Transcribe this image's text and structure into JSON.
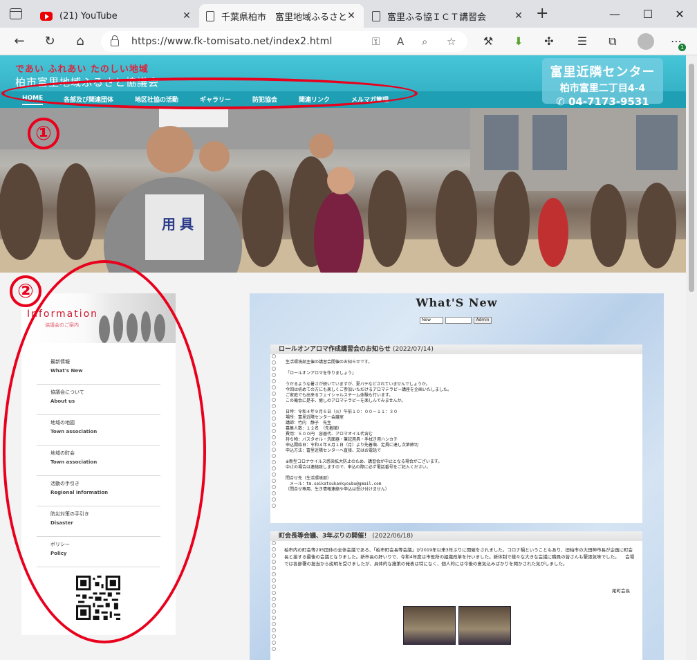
{
  "browser": {
    "tabs": [
      {
        "title": "(21) YouTube",
        "icon": "youtube-icon",
        "active": false
      },
      {
        "title": "千葉県柏市　富里地域ふるさと協議会",
        "icon": "page-icon",
        "active": true
      },
      {
        "title": "富里ふる協ＩＣＴ講習会",
        "icon": "page-icon",
        "active": false
      }
    ],
    "url": "https://www.fk-tomisato.net/index2.html",
    "profile_badge": "1"
  },
  "site": {
    "slogan": "であい ふれあい たのしい地域",
    "org_name": "柏市富里地域ふるさと協議会",
    "center": {
      "name": "富里近隣センター",
      "address": "柏市富里二丁目4-4",
      "tel": "✆ 04-7173-9531"
    },
    "nav": [
      "HOME",
      "各部及び関連団体",
      "地区社協の活動",
      "ギャラリー",
      "防犯協会",
      "関連リンク",
      "メルマガ管理"
    ]
  },
  "hero": {
    "bib_text": "用具"
  },
  "sidebar": {
    "title": "Information",
    "subtitle": "協議会のご案内",
    "menu": [
      {
        "jp": "最新情報",
        "en": "What's New"
      },
      {
        "jp": "協議会について",
        "en": "About us"
      },
      {
        "jp": "地域の地図",
        "en": "Town association"
      },
      {
        "jp": "地域の町会",
        "en": "Town association"
      },
      {
        "jp": "活動の手引き",
        "en": "Regional information"
      },
      {
        "jp": "防災対策の手引き",
        "en": "Disaster"
      },
      {
        "jp": "ポリシー",
        "en": "Policy"
      }
    ]
  },
  "whatsnew": {
    "title": "What'S New",
    "select_value": "New",
    "admin_label": "Admin",
    "posts": [
      {
        "title": "ロールオンアロマ作成講習会のお知らせ",
        "date": "(2022/07/14)",
        "body": "生活環境部主催の講習会開催のお知らせです。\n\n「ロールオンアロマを作りましょう」\n\nうだるような暑さが続いていますが、夏バテなどされていませんでしょうか。\n今回は初めての方にも楽しくご参加いただけるアロマテラピー講座を企画いたしました。\nご家庭でも出来るフェイシャルスチーム体験も行います。\nこの機会に是非、癒しのアロマテラピーを楽しんでみませんか。\n\n日時：令和４年９月６日（火）午前１０：００－１１：３０\n場所：富里近隣センター会議室\n講師：竹内　静子　先生\n募集人数：１２名　（先着順）\n費用：５００円　容器代、アロマオイル代含む\n持ち物：バスタオル・洗面器・筆記用具・手拭き用ハンカチ\n申込開始日：令和４年８月１日（月）より先着順、定員に達し次第締切\n申込方法：富里近隣センターへ直接、又はお電話で\n\n※新型コロナウイルス感染拡大防止のため、講習会が中止となる場合がございます。\n中止の場合は連絡致しますので、申込の際に必ず電話番号をご記入ください。\n\n問合せ先（生活環境部）\n　メール：tm.seikatsukankyoubu@gmail.com\n（問合せ専用、生き情報連絡や申込は受け付けません）"
      },
      {
        "title": "町会長等会議、3年ぶりの開催！",
        "date": "(2022/06/18)",
        "body": "柏市内の町会等295団体の全体会議である、「柏市町会長等会議」が2019年以来3年ぶりに開催をされました。コロナ禍ということもあり、旧柏市の大田神市長が企画に町会長と接する最後の会議となりました。新市長の肝いりで、令和4年度は市役所の組織改革を行いました。新体制で様々な大きな会議に職員の皆さんも緊張気味でした。\n　会場では各部署の担当から説明を受けましたが、具体的な施策の発表は特になく、個人的には今後の意気込みばかりを聞かされた気がしました。",
        "signature": "尾町会長"
      }
    ]
  },
  "annotations": {
    "one": "①",
    "two": "②",
    "color": "#e8001c"
  }
}
